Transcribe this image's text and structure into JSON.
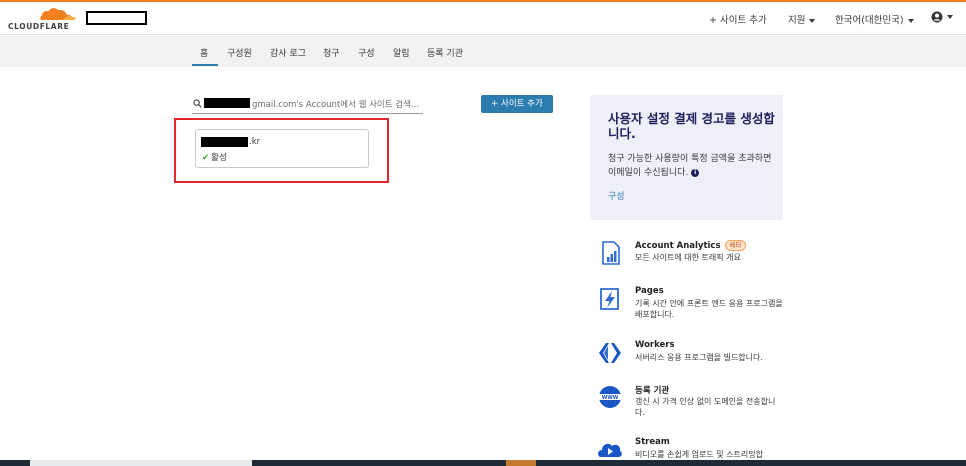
{
  "brand": {
    "name": "CLOUDFLARE",
    "accent": "#f38020"
  },
  "header": {
    "add_site": "+ 사이트 추가",
    "support": "지원",
    "language": "한국어(대한민국)",
    "user_icon": "user-circle-icon"
  },
  "tabs": [
    {
      "label": "홈",
      "active": true
    },
    {
      "label": "구성원"
    },
    {
      "label": "감사 로그"
    },
    {
      "label": "청구"
    },
    {
      "label": "구성"
    },
    {
      "label": "알림"
    },
    {
      "label": "등록 기관"
    }
  ],
  "search": {
    "text": "gmail.com's Account에서 웹 사이트 검색..."
  },
  "add_site_button": "+ 사이트 추가",
  "site": {
    "tld": ".kr",
    "status_icon": "check-icon",
    "status": "활성"
  },
  "promo": {
    "title": "사용자 설정 결제 경고를 생성합니다.",
    "body": "청구 가능한 사용량이 특정 금액을 초과하면 이메일이 수신됩니다.",
    "link": "구성"
  },
  "products": [
    {
      "name": "Account Analytics",
      "badge": "베타",
      "desc": "모든 사이트에 대한 트래픽 개요",
      "icon": "analytics-icon"
    },
    {
      "name": "Pages",
      "desc": "기록 시간 안에 프론트 엔드 응용 프로그램을 배포합니다.",
      "icon": "pages-bolt-icon"
    },
    {
      "name": "Workers",
      "desc": "서버리스 응용 프로그램을 빌드합니다.",
      "icon": "workers-icon"
    },
    {
      "name": "등록 기관",
      "desc": "갱신 시 가격 인상 없이 도메인을 전송합니다.",
      "icon": "www-globe-icon"
    },
    {
      "name": "Stream",
      "desc": "비디오를 손쉽게 업로드 및 스트리밍합",
      "icon": "stream-cloud-icon"
    }
  ]
}
